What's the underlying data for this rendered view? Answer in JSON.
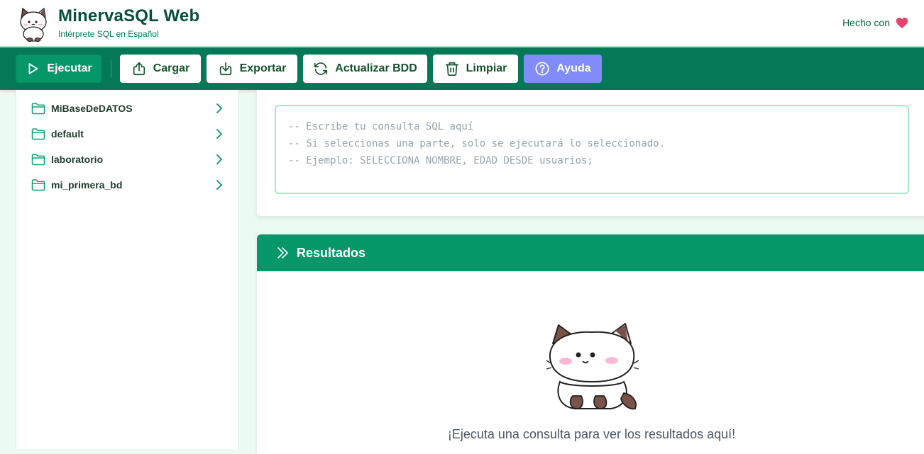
{
  "header": {
    "title": "MinervaSQL Web",
    "subtitle": "Intérprete SQL en Español",
    "made_with": "Hecho con"
  },
  "toolbar": {
    "run_label": "Ejecutar",
    "load_label": "Cargar",
    "export_label": "Exportar",
    "refresh_label": "Actualizar BDD",
    "clear_label": "Limpiar",
    "help_label": "Ayuda"
  },
  "sidebar": {
    "databases": [
      {
        "label": "MiBaseDeDATOS"
      },
      {
        "label": "default"
      },
      {
        "label": "laboratorio"
      },
      {
        "label": "mi_primera_bd"
      }
    ]
  },
  "editor": {
    "placeholder": "-- Escribe tu consulta SQL aquí\n-- Si seleccionas una parte, solo se ejecutará lo seleccionado.\n-- Ejemplo: SELECCIONA NOMBRE, EDAD DESDE usuarios;"
  },
  "results": {
    "title": "Resultados",
    "empty_message": "¡Ejecuta una consulta para ver los resultados aquí!"
  },
  "colors": {
    "toolbar_bg": "#047857",
    "accent": "#059669",
    "help_button": "#818cf8",
    "heart": "#e11d48"
  },
  "icons": {
    "run": "play-icon",
    "load": "upload-icon",
    "export": "download-icon",
    "refresh": "refresh-icon",
    "clear": "trash-icon",
    "help": "question-circle-icon",
    "folder": "folder-icon",
    "chevron": "chevron-right-icon",
    "results": "double-chevron-icon",
    "heart": "heart-icon"
  }
}
